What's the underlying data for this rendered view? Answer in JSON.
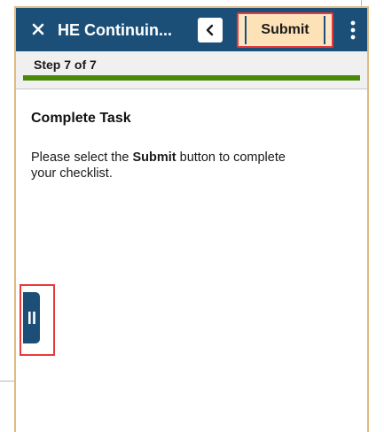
{
  "header": {
    "title": "HE Continuin...",
    "submit_label": "Submit",
    "close_icon": "close-icon",
    "back_icon": "chevron-left-icon",
    "more_icon": "more-vertical-icon"
  },
  "progress": {
    "step_label": "Step 7 of 7",
    "fraction": 1.0
  },
  "content": {
    "heading": "Complete Task",
    "instruction_before": "Please select the ",
    "instruction_bold": "Submit",
    "instruction_after": " button to complete your checklist."
  },
  "side_panel": {
    "icon": "pause-icon"
  },
  "colors": {
    "header_bg": "#1c4f78",
    "submit_bg": "#fde6c4",
    "highlight": "#e83a3a",
    "progress": "#4a8a08",
    "frame_border": "#e0b983"
  }
}
